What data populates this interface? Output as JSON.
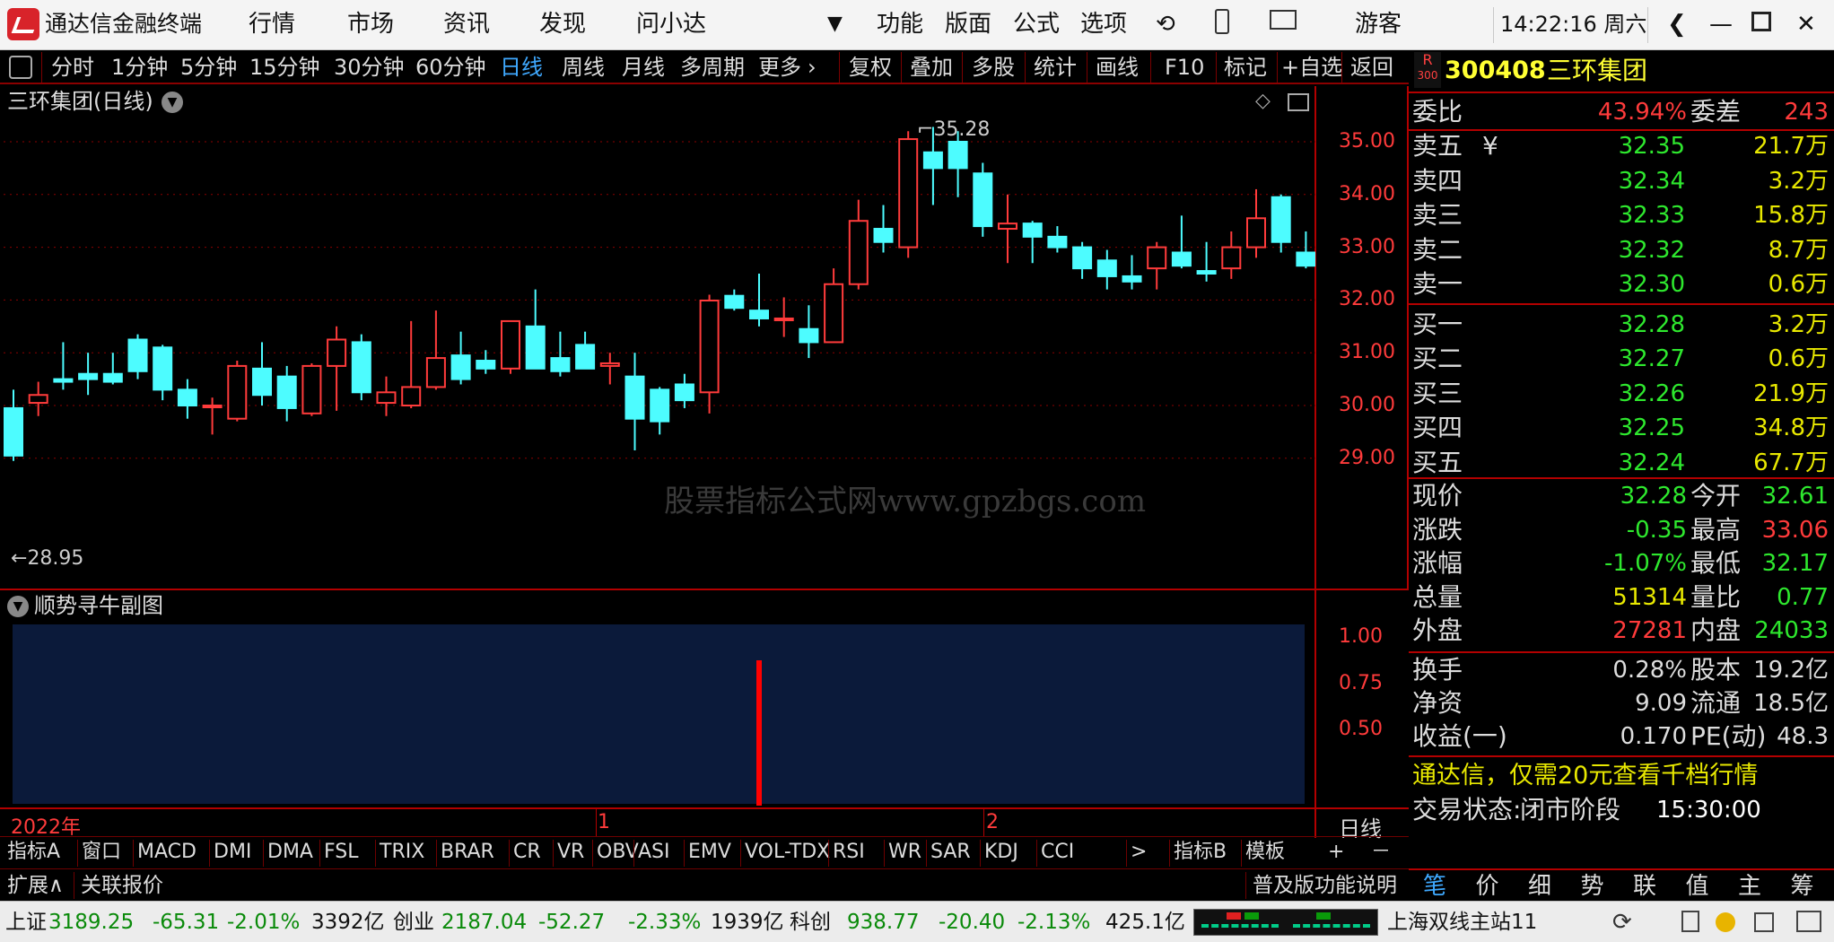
{
  "app": {
    "title": "通达信金融终端",
    "menu": [
      "行情",
      "市场",
      "资讯",
      "发现",
      "问小达"
    ],
    "menu2": [
      "功能",
      "版面",
      "公式",
      "选项"
    ],
    "user": "游客",
    "clock": "14:22:16 周六"
  },
  "periods": [
    "分时",
    "1分钟",
    "5分钟",
    "15分钟",
    "30分钟",
    "60分钟",
    "日线",
    "周线",
    "月线",
    "多周期",
    "更多"
  ],
  "tools": [
    "复权",
    "叠加",
    "多股",
    "统计",
    "画线",
    "F10",
    "标记",
    "+自选",
    "返回"
  ],
  "chart": {
    "title": "三环集团(日线)",
    "high_label": "35.28",
    "low_label": "28.95",
    "watermark": "股票指标公式网www.gpzbgs.com",
    "yticks": [
      "35.00",
      "34.00",
      "33.00",
      "32.00",
      "31.00",
      "30.00",
      "29.00"
    ],
    "date_labels": [
      "2022年",
      "1",
      "2"
    ],
    "period_tag": "日线"
  },
  "subchart": {
    "title": "顺势寻牛副图",
    "yticks": [
      "1.00",
      "0.75",
      "0.50"
    ]
  },
  "chart_data": {
    "type": "candlestick",
    "title": "三环集团(日线)",
    "ylim": [
      28.6,
      35.8
    ],
    "candles": [
      [
        29.95,
        30.3,
        28.95,
        29.05
      ],
      [
        30.05,
        30.45,
        29.8,
        30.2
      ],
      [
        30.5,
        31.2,
        30.3,
        30.45
      ],
      [
        30.6,
        31.0,
        30.2,
        30.5
      ],
      [
        30.6,
        31.0,
        30.4,
        30.45
      ],
      [
        31.25,
        31.35,
        30.5,
        30.65
      ],
      [
        31.1,
        31.15,
        30.1,
        30.3
      ],
      [
        30.3,
        30.5,
        29.75,
        30.0
      ],
      [
        30.0,
        30.15,
        29.45,
        30.0
      ],
      [
        29.75,
        30.85,
        29.7,
        30.75
      ],
      [
        30.7,
        31.2,
        30.0,
        30.2
      ],
      [
        30.55,
        30.75,
        29.7,
        29.95
      ],
      [
        29.85,
        30.8,
        29.8,
        30.75
      ],
      [
        30.75,
        31.5,
        29.9,
        31.25
      ],
      [
        31.2,
        31.35,
        30.1,
        30.25
      ],
      [
        30.05,
        30.55,
        29.8,
        30.25
      ],
      [
        30.0,
        31.6,
        29.95,
        30.35
      ],
      [
        30.35,
        31.8,
        30.3,
        30.9
      ],
      [
        30.95,
        31.4,
        30.4,
        30.5
      ],
      [
        30.85,
        31.05,
        30.6,
        30.7
      ],
      [
        30.7,
        31.6,
        30.6,
        31.6
      ],
      [
        31.5,
        32.2,
        30.9,
        30.7
      ],
      [
        30.9,
        31.4,
        30.55,
        30.65
      ],
      [
        31.15,
        31.4,
        30.9,
        30.7
      ],
      [
        30.75,
        31.0,
        30.4,
        30.8
      ],
      [
        30.55,
        31.0,
        29.15,
        29.75
      ],
      [
        30.3,
        30.35,
        29.45,
        29.7
      ],
      [
        30.4,
        30.6,
        29.95,
        30.1
      ],
      [
        30.25,
        32.1,
        29.85,
        31.99
      ],
      [
        32.08,
        32.2,
        31.8,
        31.85
      ],
      [
        31.8,
        32.5,
        31.5,
        31.65
      ],
      [
        31.65,
        32.05,
        31.3,
        31.65
      ],
      [
        31.45,
        31.9,
        30.9,
        31.2
      ],
      [
        31.2,
        32.6,
        31.2,
        32.3
      ],
      [
        32.3,
        33.9,
        32.2,
        33.5
      ],
      [
        33.35,
        33.8,
        32.9,
        33.1
      ],
      [
        33.0,
        35.2,
        32.8,
        35.05
      ],
      [
        34.8,
        35.28,
        33.8,
        34.5
      ],
      [
        35.0,
        35.2,
        33.95,
        34.5
      ],
      [
        34.4,
        34.6,
        33.2,
        33.4
      ],
      [
        33.35,
        34.0,
        32.7,
        33.45
      ],
      [
        33.45,
        33.5,
        32.7,
        33.2
      ],
      [
        33.2,
        33.4,
        32.9,
        33.0
      ],
      [
        33.0,
        33.1,
        32.4,
        32.6
      ],
      [
        32.75,
        32.95,
        32.2,
        32.45
      ],
      [
        32.45,
        32.85,
        32.2,
        32.35
      ],
      [
        32.6,
        33.1,
        32.2,
        33.0
      ],
      [
        32.9,
        33.6,
        32.6,
        32.65
      ],
      [
        32.55,
        33.1,
        32.35,
        32.5
      ],
      [
        32.6,
        33.3,
        32.4,
        33.0
      ],
      [
        33.0,
        34.1,
        32.8,
        33.55
      ],
      [
        33.95,
        34.0,
        32.9,
        33.1
      ],
      [
        32.9,
        33.3,
        32.6,
        32.65
      ],
      [
        32.7,
        33.15,
        32.45,
        32.95
      ]
    ],
    "signal_index": 30,
    "sub_ylim": [
      0.35,
      1.05
    ]
  },
  "right": {
    "r_badge": "R",
    "r_sub": "300",
    "code": "300408",
    "name": "三环集团",
    "weibi_label": "委比",
    "weibi": "43.94%",
    "weicha_label": "委差",
    "weicha": "243",
    "book": [
      {
        "label": "卖五",
        "price": "32.35",
        "vol": "21.7万",
        "yen": "¥"
      },
      {
        "label": "卖四",
        "price": "32.34",
        "vol": "3.2万"
      },
      {
        "label": "卖三",
        "price": "32.33",
        "vol": "15.8万"
      },
      {
        "label": "卖二",
        "price": "32.32",
        "vol": "8.7万"
      },
      {
        "label": "卖一",
        "price": "32.30",
        "vol": "0.6万"
      },
      {
        "label": "买一",
        "price": "32.28",
        "vol": "3.2万"
      },
      {
        "label": "买二",
        "price": "32.27",
        "vol": "0.6万"
      },
      {
        "label": "买三",
        "price": "32.26",
        "vol": "21.9万"
      },
      {
        "label": "买四",
        "price": "32.25",
        "vol": "34.8万"
      },
      {
        "label": "买五",
        "price": "32.24",
        "vol": "67.7万"
      }
    ],
    "stats": [
      {
        "l1": "现价",
        "v1": "32.28",
        "c1": "#2ee82e",
        "l2": "今开",
        "v2": "32.61",
        "c2": "#2ee82e"
      },
      {
        "l1": "涨跌",
        "v1": "-0.35",
        "c1": "#2ee82e",
        "l2": "最高",
        "v2": "33.06",
        "c2": "#ff3b3b"
      },
      {
        "l1": "涨幅",
        "v1": "-1.07%",
        "c1": "#2ee82e",
        "l2": "最低",
        "v2": "32.17",
        "c2": "#2ee82e"
      },
      {
        "l1": "总量",
        "v1": "51314",
        "c1": "#e8e800",
        "l2": "量比",
        "v2": "0.77",
        "c2": "#2ee82e"
      },
      {
        "l1": "外盘",
        "v1": "27281",
        "c1": "#ff3b3b",
        "l2": "内盘",
        "v2": "24033",
        "c2": "#2ee82e"
      }
    ],
    "stats2": [
      {
        "l1": "换手",
        "v1": "0.28%",
        "l2": "股本",
        "v2": "19.2亿"
      },
      {
        "l1": "净资",
        "v1": "9.09",
        "l2": "流通",
        "v2": "18.5亿"
      },
      {
        "l1": "收益(一)",
        "v1": "0.170",
        "l2": "PE(动)",
        "v2": "48.3"
      }
    ],
    "promo": "通达信，仅需20元查看千档行情",
    "trade_state_label": "交易状态:",
    "trade_state": "闭市阶段",
    "trade_time": "15:30:00",
    "tabs": [
      "笔",
      "价",
      "细",
      "势",
      "联",
      "值",
      "主",
      "筹"
    ]
  },
  "indicators": [
    "指标A",
    "窗口",
    "MACD",
    "DMI",
    "DMA",
    "FSL",
    "TRIX",
    "BRAR",
    "CR",
    "VR",
    "OBV",
    "ASI",
    "EMV",
    "VOL-TDX",
    "RSI",
    "WR",
    "SAR",
    "KDJ",
    "CCI",
    ">",
    "指标B",
    "模板",
    "+",
    "－"
  ],
  "ext": {
    "expand": "扩展∧",
    "related": "关联报价",
    "guide": "普及版功能说明"
  },
  "ticker": {
    "sh": "上证",
    "sh_val": "3189.25",
    "sh_chg": "-65.31",
    "sh_pct": "-2.01%",
    "sh_amt": "3392亿",
    "cy": "创业",
    "cy_val": "2187.04",
    "cy_chg": "-52.27",
    "cy_pct": "-2.33%",
    "cy_amt": "1939亿",
    "kc": "科创",
    "kc_val": "938.77",
    "kc_chg": "-20.40",
    "kc_pct": "-2.13%",
    "kc_amt": "425.1亿",
    "station": "上海双线主站11"
  },
  "colors": {
    "up": "#ff3b3b",
    "down": "#4dfcff",
    "grid": "#8b0000",
    "signal": "#ff0000",
    "sub_bg": "#0b1a3a"
  }
}
